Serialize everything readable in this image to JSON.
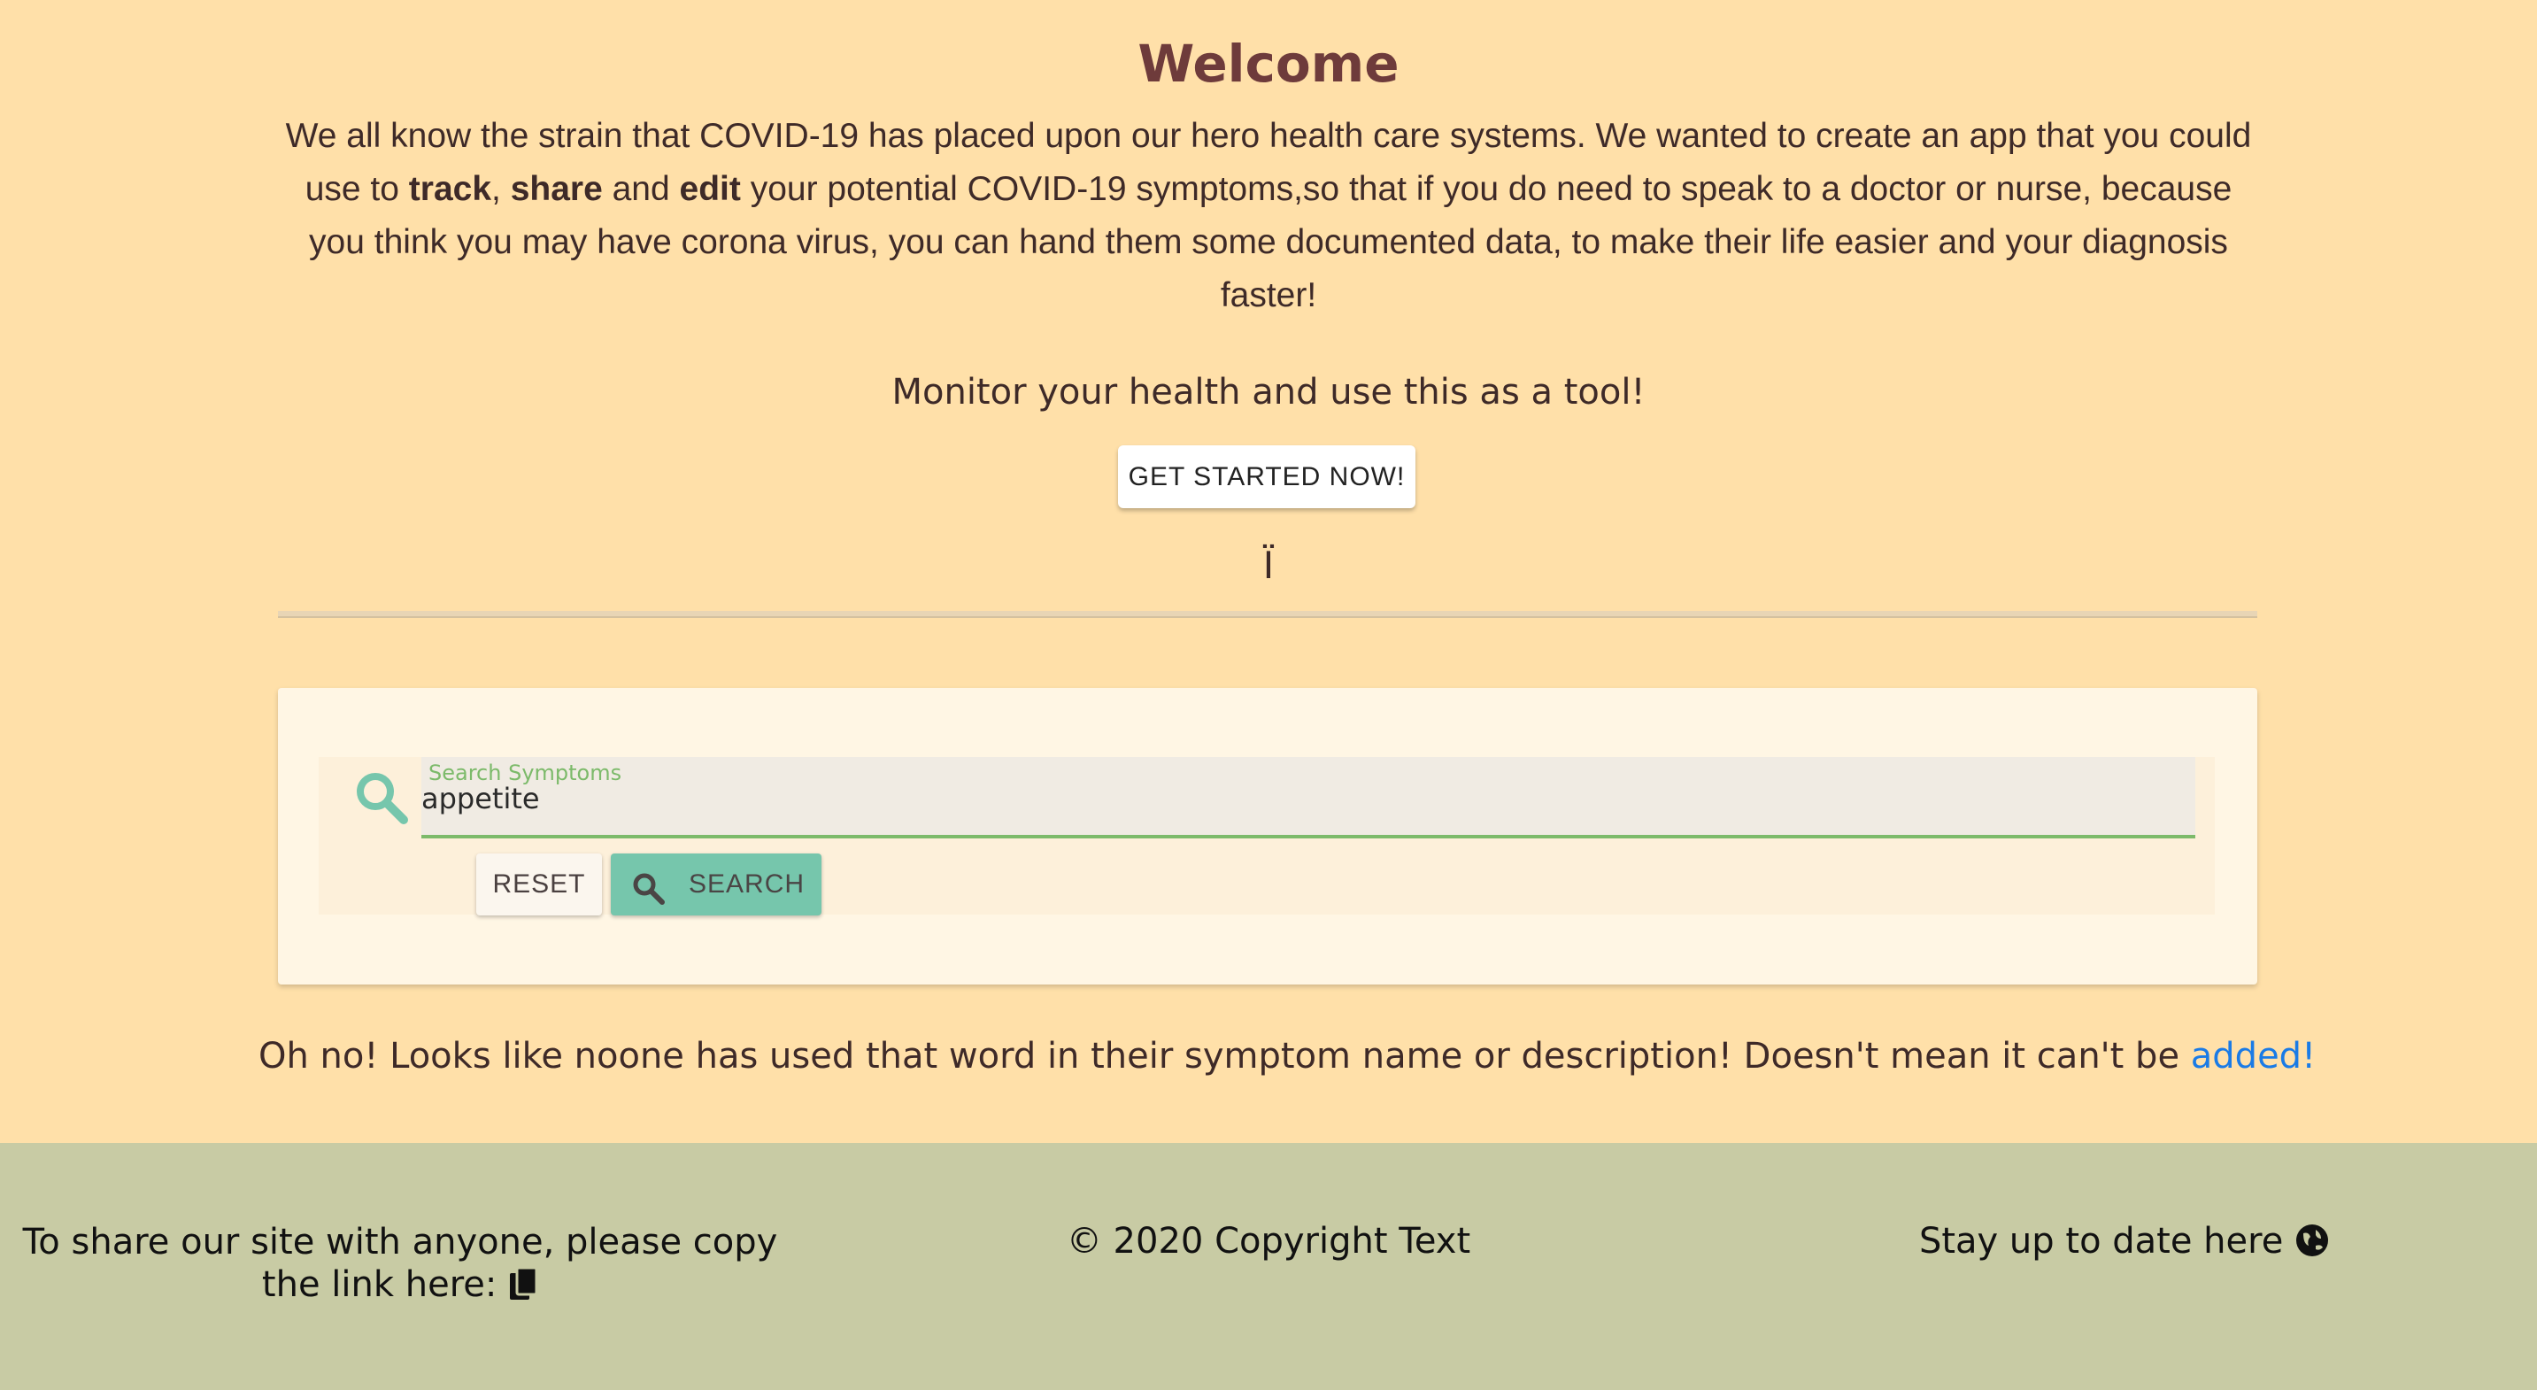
{
  "hero": {
    "title": "Welcome",
    "intro_part1": "We all know the strain that COVID-19 has placed upon our hero health care systems. We wanted to create an app that you could use to ",
    "bold_track": "track",
    "comma": ", ",
    "bold_share": "share",
    "and": " and ",
    "bold_edit": "edit",
    "intro_part2": " your potential COVID-19 symptoms,so that if you do need to speak to a doctor or nurse, because you think you may have corona virus, you can hand them some documented data, to make their life easier and your diagnosis faster!",
    "monitor_text": "Monitor your health and use this as a tool!",
    "cta_label": "GET STARTED NOW!",
    "glyph": "Ï"
  },
  "search": {
    "label": "Search Symptoms",
    "value": "appetite",
    "reset_label": "RESET",
    "search_label": "SEARCH",
    "icon": "search-icon"
  },
  "result": {
    "message": "Oh no! Looks like noone has used that word in their symptom name or description! Doesn't mean it can't be ",
    "link_text": "added!"
  },
  "footer": {
    "share_text": "To share our site with anyone, please copy the link here:",
    "share_icon": "copy-icon",
    "copyright": "© 2020 Copyright Text",
    "stay_text": "Stay up to date here",
    "stay_icon": "globe-icon"
  },
  "colors": {
    "background": "#ffe0a9",
    "title": "#6e3b3b",
    "accent_green": "#76c6ac",
    "field_underline": "#7cba6a",
    "link": "#1a7be6",
    "footer_bg": "#c8cba4"
  }
}
